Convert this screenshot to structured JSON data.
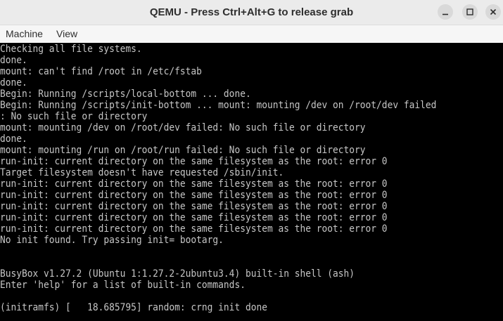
{
  "window": {
    "title": "QEMU - Press Ctrl+Alt+G to release grab"
  },
  "menu": {
    "items": [
      "Machine",
      "View"
    ]
  },
  "console": {
    "lines": [
      "Checking all file systems.",
      "done.",
      "mount: can't find /root in /etc/fstab",
      "done.",
      "Begin: Running /scripts/local-bottom ... done.",
      "Begin: Running /scripts/init-bottom ... mount: mounting /dev on /root/dev failed",
      ": No such file or directory",
      "mount: mounting /dev on /root/dev failed: No such file or directory",
      "done.",
      "mount: mounting /run on /root/run failed: No such file or directory",
      "run-init: current directory on the same filesystem as the root: error 0",
      "Target filesystem doesn't have requested /sbin/init.",
      "run-init: current directory on the same filesystem as the root: error 0",
      "run-init: current directory on the same filesystem as the root: error 0",
      "run-init: current directory on the same filesystem as the root: error 0",
      "run-init: current directory on the same filesystem as the root: error 0",
      "run-init: current directory on the same filesystem as the root: error 0",
      "No init found. Try passing init= bootarg.",
      "",
      "",
      "BusyBox v1.27.2 (Ubuntu 1:1.27.2-2ubuntu3.4) built-in shell (ash)",
      "Enter 'help' for a list of built-in commands.",
      "",
      "(initramfs) [   18.685795] random: crng init done"
    ]
  }
}
